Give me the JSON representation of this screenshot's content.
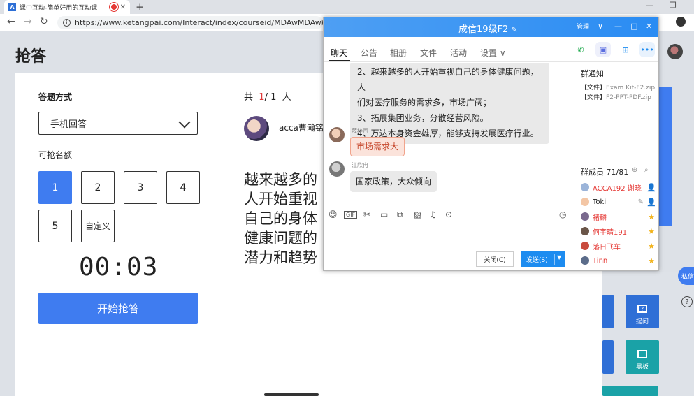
{
  "browser": {
    "tab_title": "课中互动-简单好用的互动课",
    "tab_close": "✕",
    "new_tab": "+",
    "win_min": "—",
    "win_max": "❐",
    "url": "https://www.ketangpai.com/Interact/index/courseid/MDAwMDAwMDAw",
    "back": "←",
    "forward": "→",
    "reload": "↻"
  },
  "page": {
    "title": "抢答",
    "answer_mode_label": "答题方式",
    "answer_mode_value": "手机回答",
    "quota_label": "可抢名额",
    "quota_buttons": [
      "1",
      "2",
      "3",
      "4",
      "5",
      "自定义"
    ],
    "selected_quota": "1",
    "timer": "00:03",
    "start_label": "开始抢答",
    "count_prefix": "共",
    "count_current": "1",
    "count_rest": "/ 1",
    "count_suffix": "人",
    "student_name": "acca曹瀚铭",
    "answer_text": "越来越多的人开始重视自己的身体健康问题的潜力和趋势"
  },
  "side_tools": {
    "tool1": "提问",
    "tool2": "黑板",
    "help": "?",
    "private": "私信"
  },
  "chat": {
    "title": "成信19级F2",
    "title_edit": "✎",
    "titlebar_icons": [
      "☷",
      "∨",
      "—",
      "□",
      "✕"
    ],
    "titlebar_text": "管理",
    "tabs": [
      "聊天",
      "公告",
      "相册",
      "文件",
      "活动",
      "设置 ∨"
    ],
    "messages": [
      {
        "lines": [
          "2、越来越多的人开始重视自己的身体健康问题，人",
          "们对医疗服务的需求多，市场广阔；",
          "3、拓展集团业务，分散经营风险。",
          "4、万达本身资金雄厚，能够支持发展医疗行业。"
        ]
      },
      {
        "sender": "薛梓西",
        "text": "市场需求大"
      },
      {
        "sender": "江欣冉",
        "text": "国家政策，大众倾向"
      }
    ],
    "close_label": "关闭(C)",
    "send_label": "发送(S)",
    "notice_title": "群通知",
    "notices": [
      {
        "tag": "【文件】",
        "name": "Exam Kit-F2.zip"
      },
      {
        "tag": "【文件】",
        "name": "F2-PPT-PDF.zip"
      }
    ],
    "members_title": "群成员 71/81",
    "members": [
      {
        "name": "ACCA192 谢晓",
        "color": "#e53935",
        "badge": "👤",
        "av": "#9bb4d9"
      },
      {
        "name": "Toki",
        "color": "#222",
        "badge": "👤",
        "av": "#f3c6a5",
        "edit": "✎"
      },
      {
        "name": "褚麟",
        "color": "#e53935",
        "badge": "★",
        "av": "#7a6a8e"
      },
      {
        "name": "何宇晴191",
        "color": "#e53935",
        "badge": "★",
        "av": "#6a5548"
      },
      {
        "name": "落日飞车",
        "color": "#e53935",
        "badge": "★",
        "av": "#c94b3d"
      },
      {
        "name": "Tinn",
        "color": "#e53935",
        "badge": "★",
        "av": "#5b6c8a"
      }
    ]
  }
}
